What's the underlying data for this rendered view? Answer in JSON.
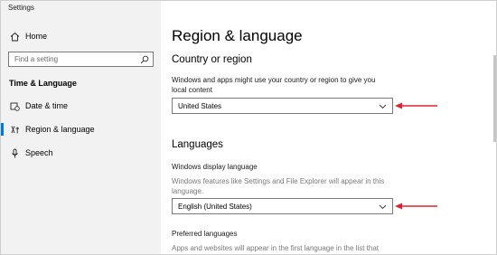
{
  "window": {
    "title": "Settings"
  },
  "sidebar": {
    "home_label": "Home",
    "search_placeholder": "Find a setting",
    "section_label": "Time & Language",
    "items": [
      {
        "label": "Date & time",
        "icon": "calendar-clock-icon"
      },
      {
        "label": "Region & language",
        "icon": "region-language-icon",
        "selected": true
      },
      {
        "label": "Speech",
        "icon": "microphone-icon"
      }
    ]
  },
  "main": {
    "page_title": "Region & language",
    "country": {
      "heading": "Country or region",
      "description": "Windows and apps might use your country or region to give you local content",
      "selected": "United States"
    },
    "languages": {
      "heading": "Languages",
      "display_label": "Windows display language",
      "display_description": "Windows features like Settings and File Explorer will appear in this language.",
      "display_selected": "English (United States)",
      "preferred_label": "Preferred languages",
      "preferred_description": "Apps and websites will appear in the first language in the list that"
    }
  },
  "colors": {
    "accent": "#0078d7",
    "arrow": "#e0232f",
    "sidebar_bg": "#f2f2f2"
  }
}
